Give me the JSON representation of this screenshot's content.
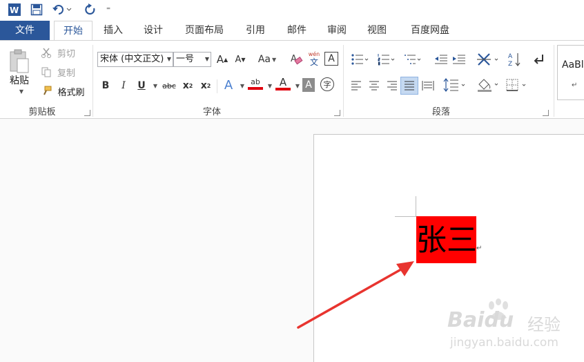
{
  "quick_access": {
    "customize": "⁼"
  },
  "tabs": [
    {
      "label": "文件"
    },
    {
      "label": "开始"
    },
    {
      "label": "插入"
    },
    {
      "label": "设计"
    },
    {
      "label": "页面布局"
    },
    {
      "label": "引用"
    },
    {
      "label": "邮件"
    },
    {
      "label": "审阅"
    },
    {
      "label": "视图"
    },
    {
      "label": "百度网盘"
    }
  ],
  "clipboard": {
    "paste": "粘贴",
    "cut": "剪切",
    "copy": "复制",
    "format_painter": "格式刷",
    "group": "剪贴板"
  },
  "font": {
    "name": "宋体 (中文正文)",
    "size": "一号",
    "grow": "A",
    "shrink": "A",
    "case": "Aa",
    "pinyin_top": "wén",
    "pinyin_bottom": "文",
    "border_char": "A",
    "bold": "B",
    "italic": "I",
    "underline": "U",
    "strike": "abc",
    "sub": "x",
    "sub_mark": "2",
    "sup": "x",
    "sup_mark": "2",
    "effects": "A",
    "highlight": "ab",
    "color": "A",
    "shading": "A",
    "enclose": "字",
    "group": "字体"
  },
  "paragraph": {
    "group": "段落"
  },
  "styles": {
    "sample": "AaBl",
    "sample_mark": "↵"
  },
  "document": {
    "text": "张三",
    "para_mark": "↵"
  },
  "watermark": {
    "logo": "Baidu",
    "logo_cn": "经验",
    "url": "jingyan.baidu.com"
  },
  "colors": {
    "file_tab": "#2b579a",
    "highlight": "#ff0000",
    "arrow": "#e8342f"
  }
}
